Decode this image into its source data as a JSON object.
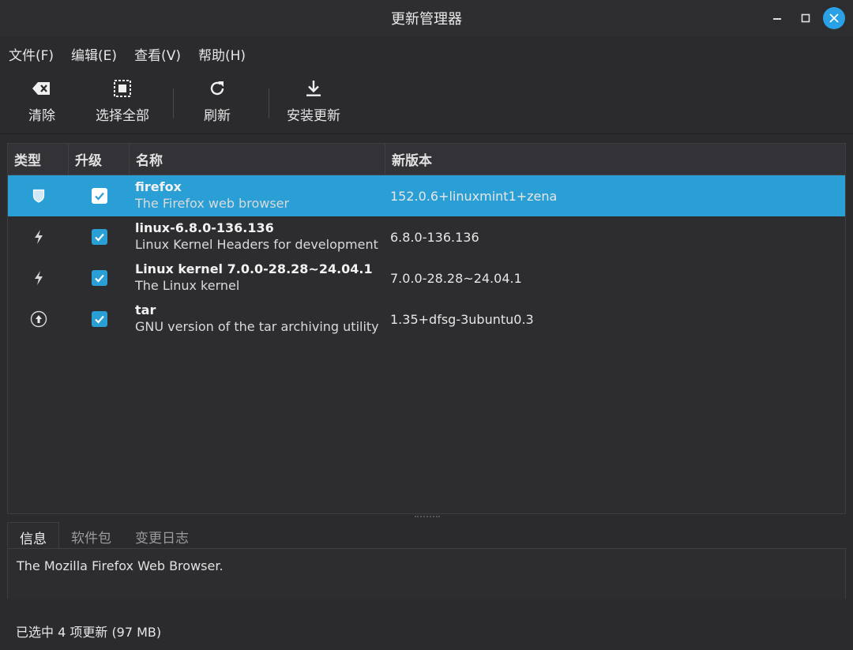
{
  "window": {
    "title": "更新管理器"
  },
  "menu": [
    "文件(F)",
    "编辑(E)",
    "查看(V)",
    "帮助(H)"
  ],
  "toolbar": {
    "clear": {
      "label": "清除",
      "icon": "backspace-icon"
    },
    "select_all": {
      "label": "选择全部",
      "icon": "select-all-icon"
    },
    "refresh": {
      "label": "刷新",
      "icon": "refresh-icon"
    },
    "install": {
      "label": "安装更新",
      "icon": "download-icon"
    }
  },
  "columns": {
    "type": "类型",
    "upgrade": "升级",
    "name": "名称",
    "new_version": "新版本"
  },
  "updates": [
    {
      "type_icon": "shield-icon",
      "checked": true,
      "name": "firefox",
      "description": "The Firefox web browser",
      "version": "152.0.6+linuxmint1+zena",
      "selected": true
    },
    {
      "type_icon": "lightning-icon",
      "checked": true,
      "name": "linux-6.8.0-136.136",
      "description": "Linux Kernel Headers for development",
      "version": "6.8.0-136.136",
      "selected": false
    },
    {
      "type_icon": "lightning-icon",
      "checked": true,
      "name": "Linux kernel 7.0.0-28.28~24.04.1",
      "description": "The Linux kernel",
      "version": "7.0.0-28.28~24.04.1",
      "selected": false
    },
    {
      "type_icon": "arrow-up-circle-icon",
      "checked": true,
      "name": "tar",
      "description": "GNU version of the tar archiving utility",
      "version": "1.35+dfsg-3ubuntu0.3",
      "selected": false
    }
  ],
  "tabs": [
    "信息",
    "软件包",
    "变更日志"
  ],
  "info": {
    "text": "The Mozilla Firefox Web Browser."
  },
  "status": {
    "text": "已选中 4 项更新 (97 MB)"
  },
  "colors": {
    "accent": "#2a9fd6",
    "background": "#2b2b2e"
  }
}
